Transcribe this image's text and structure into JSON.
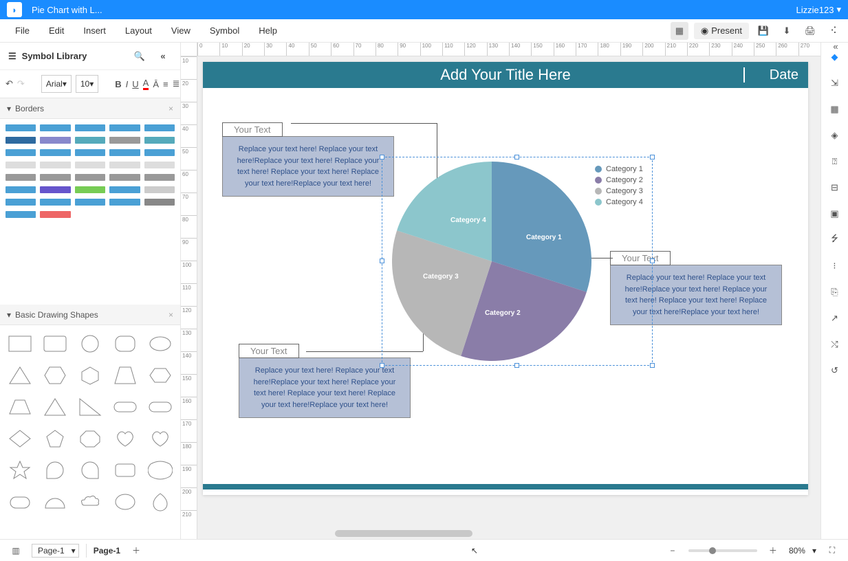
{
  "titlebar": {
    "doc_title": "Pie Chart with L...",
    "user": "Lizzie123"
  },
  "menubar": {
    "items": [
      "File",
      "Edit",
      "Insert",
      "Layout",
      "View",
      "Symbol",
      "Help"
    ],
    "present": "Present"
  },
  "toolbar": {
    "font": "Arial",
    "font_size": "10"
  },
  "left_panel": {
    "title": "Symbol Library",
    "section_borders": "Borders",
    "section_shapes": "Basic Drawing Shapes"
  },
  "page": {
    "title": "Add Your Title Here",
    "date": "Date",
    "annot_label": "Your Text",
    "annot_body": "Replace your text here!   Replace your text here!Replace your text here!   Replace your text here!   Replace your text here!   Replace your text here!Replace your text here!"
  },
  "chart_data": {
    "type": "pie",
    "series": [
      {
        "name": "Category 1",
        "value": 30,
        "color": "#6699bb"
      },
      {
        "name": "Category 2",
        "value": 25,
        "color": "#8a7da8"
      },
      {
        "name": "Category 3",
        "value": 25,
        "color": "#b7b7b7"
      },
      {
        "name": "Category 4",
        "value": 20,
        "color": "#8cc6cc"
      }
    ],
    "title": "",
    "legend_position": "right"
  },
  "statusbar": {
    "page_select": "Page-1",
    "page_tab": "Page-1",
    "zoom": "80%"
  },
  "ruler_h": [
    0,
    10,
    20,
    30,
    40,
    50,
    60,
    70,
    80,
    90,
    100,
    110,
    120,
    130,
    140,
    150,
    160,
    170,
    180,
    190,
    200,
    210,
    220,
    230,
    240,
    250,
    260,
    270
  ],
  "ruler_v": [
    10,
    20,
    30,
    40,
    50,
    60,
    70,
    80,
    90,
    100,
    110,
    120,
    130,
    140,
    150,
    160,
    170,
    180,
    190,
    200,
    210
  ]
}
